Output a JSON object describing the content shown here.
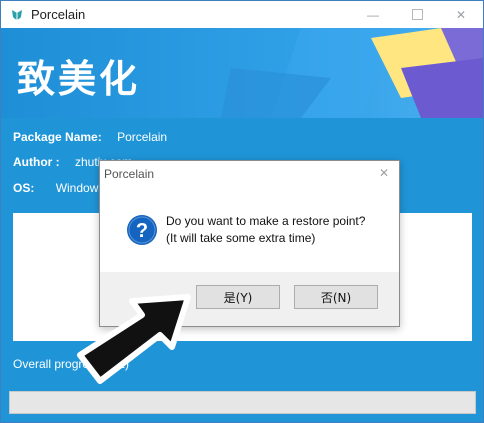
{
  "window": {
    "title": "Porcelain",
    "banner_title": "致美化"
  },
  "info": {
    "package_label": "Package Name:",
    "package_value": "Porcelain",
    "author_label": "Author :",
    "author_value": "zhutix.com",
    "os_label": "OS:",
    "os_value": "Windows"
  },
  "progress": {
    "label": "Overall progress (1/2)"
  },
  "dialog": {
    "title": "Porcelain",
    "message_line1": "Do you want to make a restore point?",
    "message_line2": "(It will take some extra time)",
    "yes_label": "是(Y)",
    "no_label": "否(N)"
  },
  "colors": {
    "window_blue": "#1f95d8",
    "question_icon": "#1565c0"
  }
}
